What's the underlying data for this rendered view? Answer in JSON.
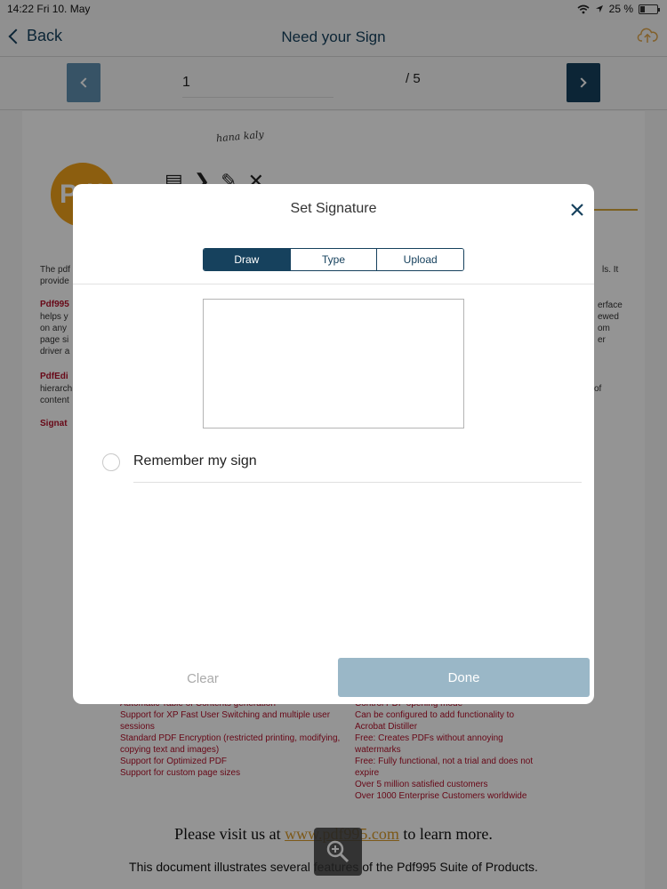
{
  "statusbar": {
    "time_date": "14:22  Fri 10. May",
    "battery": "25 %"
  },
  "navbar": {
    "back_label": "Back",
    "title": "Need your Sign",
    "upload_icon": "cloud-upload-icon"
  },
  "pager": {
    "current_page": "1",
    "total": "/ 5"
  },
  "document": {
    "signature_scrawl": "hana kaly",
    "logo_text": "Pdf",
    "para_1": [
      "The pdf",
      "provide"
    ],
    "para_1_right": [
      "ls. It"
    ],
    "red_label_1": "Pdf995",
    "para_2": [
      "helps y",
      "on any",
      "page si",
      "driver a"
    ],
    "para_2_right": [
      "erface",
      "ewed",
      "om",
      "er"
    ],
    "red_label_2": "PdfEdi",
    "para_3": [
      "hierarch",
      "content"
    ],
    "para_3_right": [
      "of"
    ],
    "red_label_3": "Signat",
    "features_left": [
      "Automatic Table of Contents generation",
      "Support for XP Fast User Switching and multiple user",
      "sessions",
      "Standard PDF Encryption (restricted printing, modifying,",
      "copying text and images)",
      "Support for Optimized PDF",
      "Support for custom page sizes"
    ],
    "features_right": [
      "Control PDF opening mode",
      "Can be configured to add functionality to",
      "Acrobat Distiller",
      "Free: Creates PDFs without annoying",
      "watermarks",
      "Free: Fully functional, not a trial and does not",
      "expire",
      "Over 5 million satisfied customers",
      "Over 1000 Enterprise Customers worldwide"
    ],
    "visit_before": "Please visit us at ",
    "visit_link": "www.pdf995.com",
    "visit_after": " to learn more.",
    "illustrates": "This document illustrates several features of the Pdf995 Suite of Products."
  },
  "modal": {
    "title": "Set Signature",
    "tabs": [
      {
        "label": "Draw",
        "active": true
      },
      {
        "label": "Type",
        "active": false
      },
      {
        "label": "Upload",
        "active": false
      }
    ],
    "remember_label": "Remember my sign",
    "clear_label": "Clear",
    "done_label": "Done"
  },
  "colors": {
    "primary": "#16415d",
    "done_disabled": "#9ab7c7",
    "accent_gold": "#d8a73a",
    "doc_red": "#b3102a"
  }
}
